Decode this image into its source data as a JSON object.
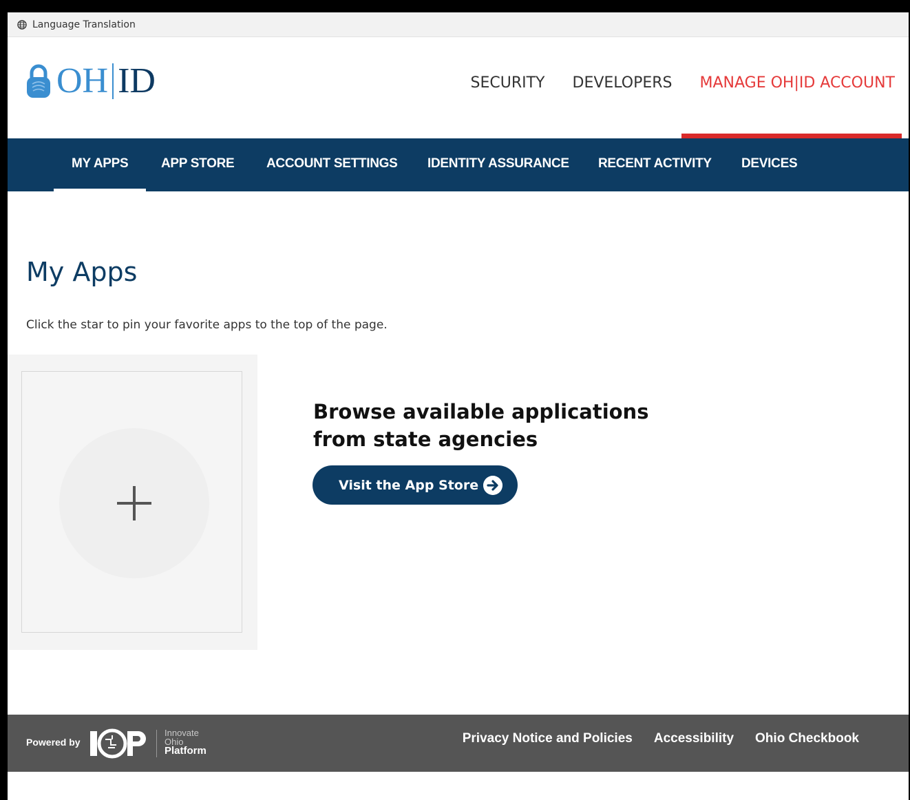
{
  "language_bar": {
    "label": "Language Translation"
  },
  "logo": {
    "left": "OH",
    "right": "ID"
  },
  "top_nav": [
    {
      "label": "SECURITY"
    },
    {
      "label": "DEVELOPERS"
    },
    {
      "label": "MANAGE OH|ID ACCOUNT",
      "active": true
    }
  ],
  "sub_nav": [
    {
      "label": "MY APPS",
      "active": true
    },
    {
      "label": "APP STORE"
    },
    {
      "label": "ACCOUNT SETTINGS"
    },
    {
      "label": "IDENTITY ASSURANCE"
    },
    {
      "label": "RECENT ACTIVITY"
    },
    {
      "label": "DEVICES"
    }
  ],
  "main": {
    "title": "My Apps",
    "intro": "Click the star to pin your favorite apps to the top of the page.",
    "browse_heading": "Browse available applications from state agencies",
    "visit_button": "Visit the App Store"
  },
  "footer": {
    "powered_by": "Powered by",
    "platform_lines": [
      "Innovate",
      "Ohio",
      "Platform"
    ],
    "links": [
      {
        "label": "Privacy Notice and Policies"
      },
      {
        "label": "Accessibility"
      },
      {
        "label": "Ohio Checkbook"
      }
    ]
  },
  "colors": {
    "navy": "#0d3c63",
    "accent_red": "#e53a3a",
    "logo_blue": "#3a8ed0",
    "footer_gray": "#555555"
  }
}
